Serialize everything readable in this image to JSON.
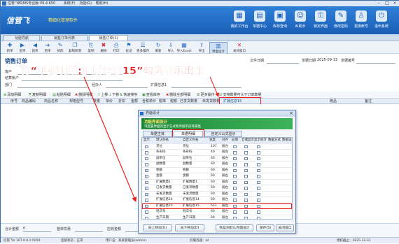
{
  "app": {
    "title": "信管飞ERMS专业版 V9.4.650",
    "menu": [
      "系统(F)",
      "功能(G)",
      "帮助(H)"
    ]
  },
  "banner": {
    "logo": "信管飞",
    "slogan": "精细化管理软件"
  },
  "nav": [
    {
      "label": "我的工作台",
      "icon": "desk-icon"
    },
    {
      "label": "单据中心",
      "icon": "doc-icon"
    },
    {
      "label": "库存查询",
      "icon": "store-icon"
    },
    {
      "label": "AI助手",
      "icon": "ai-icon"
    },
    {
      "label": "锁定界面",
      "icon": "lock-icon"
    },
    {
      "label": "修改密码",
      "icon": "key-icon"
    },
    {
      "label": "更换账号",
      "icon": "user-icon"
    },
    {
      "label": "退出系统",
      "icon": "power-icon"
    }
  ],
  "tabs": [
    "功能导航",
    "销售订单列表",
    "销售订单(1)"
  ],
  "toolbar": [
    "新单",
    "后单",
    "前单",
    "后单",
    "修改",
    "复制新增",
    "复制",
    "删除",
    "打印",
    "标记",
    "更多操作",
    "刷新",
    "导入",
    "导入Excel",
    "导出",
    "界面设计",
    "关闭窗口"
  ],
  "form": {
    "title": "销售订单",
    "labels": [
      "客户",
      "结算账户",
      "部门",
      "经办人",
      "扩展信息1",
      "文件日期",
      "单据日期",
      "单据编号"
    ],
    "date": "2025-09-13"
  },
  "annotation": "将“单据明细:扩展信息15”勾选显示出来",
  "detail_toolbar": [
    "添加明细",
    "复制明细",
    "粘贴明细",
    "删除明细",
    "上移",
    "下移",
    "快速排序",
    "查看库存",
    "删除全部明细",
    "更多操作",
    "支持数量可大于订单数量"
  ],
  "grid_headers": [
    "序号",
    "商品编码",
    "商品名称",
    "规格型号",
    "数量",
    "单价",
    "折扣",
    "金额",
    "含税单价",
    "税率",
    "税额",
    "已发货数量",
    "未发货数量",
    "扩展信息15",
    "赠品",
    "备注"
  ],
  "bottom": {
    "labels": [
      "合计金额",
      "整单优惠",
      "应收金额"
    ],
    "value": "0"
  },
  "status": {
    "version": "信管飞V 107.0.0.1:5059",
    "conn": "连接状态：正常",
    "user": "用户名：系统管理员(admin)",
    "db": "云服务器：zz",
    "extra": "授权截止：2025-12-31"
  },
  "dialog": {
    "title": "界面设计",
    "banner_title": "功能界面设计",
    "banner_sub": "可配置界面的显示方式和单据字段等属性",
    "tabs": [
      "单据主体",
      "单据明细",
      "自定义公式显示"
    ],
    "columns": [
      "显示",
      "默认列名",
      "自定义列名",
      "宽度",
      "对齐",
      "必填",
      "仓储显示",
      "显示统计",
      "数据方式",
      "数据设置"
    ],
    "rows": [
      {
        "show": false,
        "name": "货位",
        "custom": "货位",
        "width": "107",
        "align": "居左"
      },
      {
        "show": false,
        "name": "条形码",
        "custom": "条形码",
        "width": "40",
        "align": "居左"
      },
      {
        "show": false,
        "name": "副单位",
        "custom": "副单位",
        "width": "60",
        "align": "居左"
      },
      {
        "show": false,
        "name": "副数量",
        "custom": "副数量",
        "width": "60",
        "align": "居右"
      },
      {
        "show": true,
        "name": "税额",
        "custom": "税额",
        "width": "60",
        "align": "居右"
      },
      {
        "show": true,
        "name": "金额",
        "custom": "金额",
        "width": "60",
        "align": "居右"
      },
      {
        "show": false,
        "name": "扩展数量1",
        "custom": "扩展数量1",
        "width": "60",
        "align": "居右"
      },
      {
        "show": true,
        "name": "已发货数量",
        "custom": "已发货数量",
        "width": "60",
        "align": "居右"
      },
      {
        "show": true,
        "name": "未发货数量",
        "custom": "未发货数量",
        "width": "60",
        "align": "居右"
      },
      {
        "show": false,
        "name": "扩展信息14",
        "custom": "扩展信息14",
        "width": "60",
        "align": "居左"
      },
      {
        "show": true,
        "name": "扩展信息15",
        "custom": "扩展信息15",
        "width": "551",
        "align": "居左"
      },
      {
        "show": false,
        "name": "批次号",
        "custom": "批次号",
        "width": "60",
        "align": "居左"
      },
      {
        "show": false,
        "name": "生产日期",
        "custom": "生产日期",
        "width": "60",
        "align": "居左"
      },
      {
        "show": false,
        "name": "到期日期",
        "custom": "到期日期",
        "width": "60",
        "align": "居左"
      }
    ],
    "buttons": {
      "up": "向上移动(U)",
      "down": "向下移动(D)",
      "restore": "恢复到默认界面设计",
      "save": "保存(S)",
      "close": "关闭窗口"
    }
  },
  "colors": {
    "accent": "#1a5fb8",
    "annotation": "#e82020",
    "dialog_banner": "#2a9a45"
  }
}
